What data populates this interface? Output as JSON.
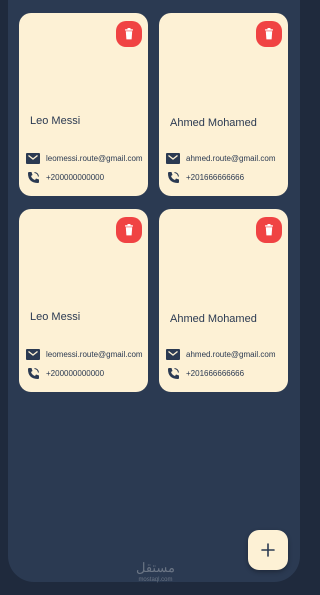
{
  "contacts": [
    {
      "name": "Leo Messi",
      "email": "leomessi.route@gmail.com",
      "phone": "+200000000000"
    },
    {
      "name": "Ahmed Mohamed",
      "email": "ahmed.route@gmail.com",
      "phone": "+201666666666"
    },
    {
      "name": "Leo Messi",
      "email": "leomessi.route@gmail.com",
      "phone": "+200000000000"
    },
    {
      "name": "Ahmed Mohamed",
      "email": "ahmed.route@gmail.com",
      "phone": "+201666666666"
    }
  ],
  "fab": {
    "icon": "plus-icon",
    "label": "+"
  },
  "watermark": {
    "brand": "مستقل",
    "domain": "mostaql.com"
  },
  "colors": {
    "background": "#2b3a52",
    "card": "#fdf1d5",
    "delete": "#f04343",
    "text": "#2b3a52"
  }
}
